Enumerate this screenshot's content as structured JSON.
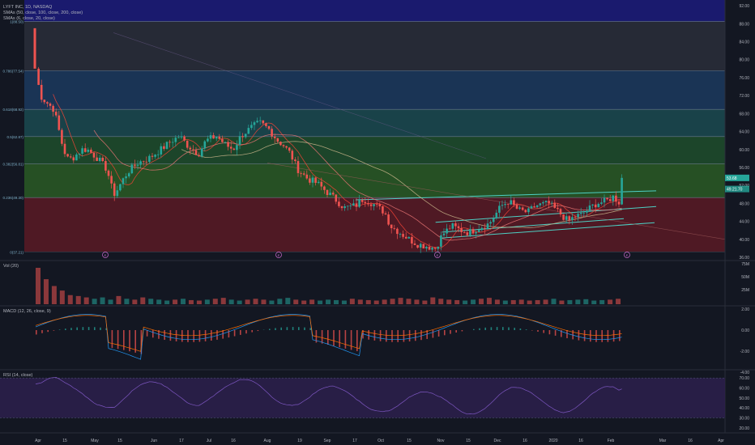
{
  "header": {
    "title": "LYFT INC, 1D, NASDAQ",
    "sma1": "SMAs (50, close, 100, close, 200, close)",
    "sma2": "SMAs (6, close, 20, close)"
  },
  "panes": {
    "volume": "Vol (20)",
    "macd": "MACD (12, 26, close, 9)",
    "rsi": "RSI (14, close)"
  },
  "price_axis": [
    "92.00",
    "88.00",
    "84.00",
    "80.00",
    "76.00",
    "72.00",
    "68.00",
    "64.00",
    "60.00",
    "56.00",
    "52.00",
    "48.00",
    "44.00",
    "40.00",
    "36.00"
  ],
  "volume_axis": [
    "75M",
    "50M",
    "25M"
  ],
  "macd_axis": [
    "2.00",
    "0.00",
    "-2.00",
    "-4.00"
  ],
  "rsi_axis": [
    "70.00",
    "60.00",
    "50.00",
    "40.00",
    "30.00",
    "20.00"
  ],
  "time_axis": [
    "Apr",
    "15",
    "May",
    "15",
    "Jun",
    "17",
    "Jul",
    "16",
    "Aug",
    "19",
    "Sep",
    "17",
    "Oct",
    "15",
    "Nov",
    "15",
    "Dec",
    "16",
    "2020",
    "16",
    "Feb",
    "Mar",
    "16",
    "Apr"
  ],
  "price_labels": {
    "last": "53.68",
    "other": "49.21.70"
  },
  "fib_labels": [
    "1(88.50)",
    "0.786(77.54)",
    "0.618(68.92)",
    "0.5(62.87)",
    "0.382(56.81)",
    "0.236(49.30)",
    "0(37.21)"
  ],
  "earnings_marker": "E",
  "colors": {
    "background": "#131722",
    "up": "#26a69a",
    "down": "#ef5350",
    "fib_top": "#1a1a6e",
    "fib_gray": "#2a2e39",
    "fib_blue": "#1c3a5e",
    "fib_teal": "#1b4a50",
    "fib_green": "#1f4d2b",
    "fib_green2": "#2a5a24",
    "fib_red": "#5a1a24",
    "rsi_band": "#2b1f4a",
    "trendline": "#4dd0c4"
  },
  "chart_data": {
    "type": "candlestick",
    "title": "LYFT INC, 1D, NASDAQ",
    "ylim": [
      36,
      94
    ],
    "fib_levels": [
      {
        "ratio": "1",
        "price": 88.5
      },
      {
        "ratio": "0.786",
        "price": 77.54
      },
      {
        "ratio": "0.618",
        "price": 68.92
      },
      {
        "ratio": "0.5",
        "price": 62.87
      },
      {
        "ratio": "0.382",
        "price": 56.81
      },
      {
        "ratio": "0.236",
        "price": 49.3
      },
      {
        "ratio": "0",
        "price": 37.21
      }
    ],
    "close_path": [
      [
        "Mar 29",
        78.0
      ],
      [
        "Apr 1",
        72.0
      ],
      [
        "Apr 3",
        71.0
      ],
      [
        "Apr 8",
        69.0
      ],
      [
        "Apr 10",
        66.0
      ],
      [
        "Apr 12",
        62.0
      ],
      [
        "Apr 15",
        58.0
      ],
      [
        "Apr 18",
        58.0
      ],
      [
        "Apr 23",
        60.0
      ],
      [
        "Apr 26",
        60.0
      ],
      [
        "May 1",
        58.0
      ],
      [
        "May 6",
        55.5
      ],
      [
        "May 8",
        52.0
      ],
      [
        "May 10",
        50.0
      ],
      [
        "May 14",
        53.0
      ],
      [
        "May 17",
        55.0
      ],
      [
        "May 22",
        57.0
      ],
      [
        "May 28",
        58.0
      ],
      [
        "Jun 4",
        60.0
      ],
      [
        "Jun 10",
        62.0
      ],
      [
        "Jun 14",
        63.0
      ],
      [
        "Jun 18",
        61.0
      ],
      [
        "Jun 24",
        59.0
      ],
      [
        "Jun 28",
        62.0
      ],
      [
        "Jul 3",
        63.0
      ],
      [
        "Jul 8",
        61.0
      ],
      [
        "Jul 12",
        60.0
      ],
      [
        "Jul 16",
        63.0
      ],
      [
        "Jul 22",
        65.0
      ],
      [
        "Jul 26",
        66.0
      ],
      [
        "Jul 31",
        64.5
      ],
      [
        "Aug 5",
        62.0
      ],
      [
        "Aug 8",
        61.0
      ],
      [
        "Aug 12",
        59.0
      ],
      [
        "Aug 14",
        57.0
      ],
      [
        "Aug 16",
        55.5
      ],
      [
        "Aug 21",
        53.5
      ],
      [
        "Aug 26",
        52.5
      ],
      [
        "Aug 30",
        51.0
      ],
      [
        "Sep 5",
        49.0
      ],
      [
        "Sep 10",
        47.0
      ],
      [
        "Sep 16",
        47.5
      ],
      [
        "Sep 20",
        49.0
      ],
      [
        "Sep 25",
        48.0
      ],
      [
        "Oct 1",
        46.0
      ],
      [
        "Oct 4",
        43.0
      ],
      [
        "Oct 9",
        41.5
      ],
      [
        "Oct 14",
        40.0
      ],
      [
        "Oct 18",
        39.0
      ],
      [
        "Oct 23",
        38.5
      ],
      [
        "Oct 28",
        38.0
      ],
      [
        "Nov 1",
        41.0
      ],
      [
        "Nov 6",
        43.0
      ],
      [
        "Nov 11",
        42.0
      ],
      [
        "Nov 15",
        41.5
      ],
      [
        "Nov 20",
        42.5
      ],
      [
        "Nov 26",
        43.5
      ],
      [
        "Dec 2",
        47.5
      ],
      [
        "Dec 6",
        48.5
      ],
      [
        "Dec 11",
        46.5
      ],
      [
        "Dec 16",
        46.0
      ],
      [
        "Dec 20",
        47.5
      ],
      [
        "Dec 27",
        48.0
      ],
      [
        "Jan 2",
        46.0
      ],
      [
        "Jan 7",
        44.0
      ],
      [
        "Jan 10",
        45.0
      ],
      [
        "Jan 14",
        45.5
      ],
      [
        "Jan 17",
        46.5
      ],
      [
        "Jan 22",
        48.0
      ],
      [
        "Jan 27",
        48.5
      ],
      [
        "Jan 31",
        49.5
      ],
      [
        "Feb 4",
        48.0
      ],
      [
        "Feb 6",
        53.68
      ]
    ],
    "volume_millions_approx": [
      80,
      55,
      40,
      30,
      20,
      18,
      15,
      12,
      15,
      10,
      18,
      12,
      10,
      15,
      12,
      10,
      8,
      10,
      12,
      9,
      8,
      10,
      12,
      14,
      10,
      8,
      10,
      12,
      10,
      8,
      12,
      14,
      10,
      8,
      10,
      8,
      10,
      9,
      8,
      12,
      10,
      9,
      8,
      10,
      12,
      14,
      12,
      10,
      8,
      15,
      12,
      10,
      9,
      8,
      10,
      12,
      14,
      10,
      8,
      9,
      10,
      8,
      9,
      10,
      12,
      8,
      9,
      10,
      11,
      8,
      9,
      10,
      12
    ]
  }
}
